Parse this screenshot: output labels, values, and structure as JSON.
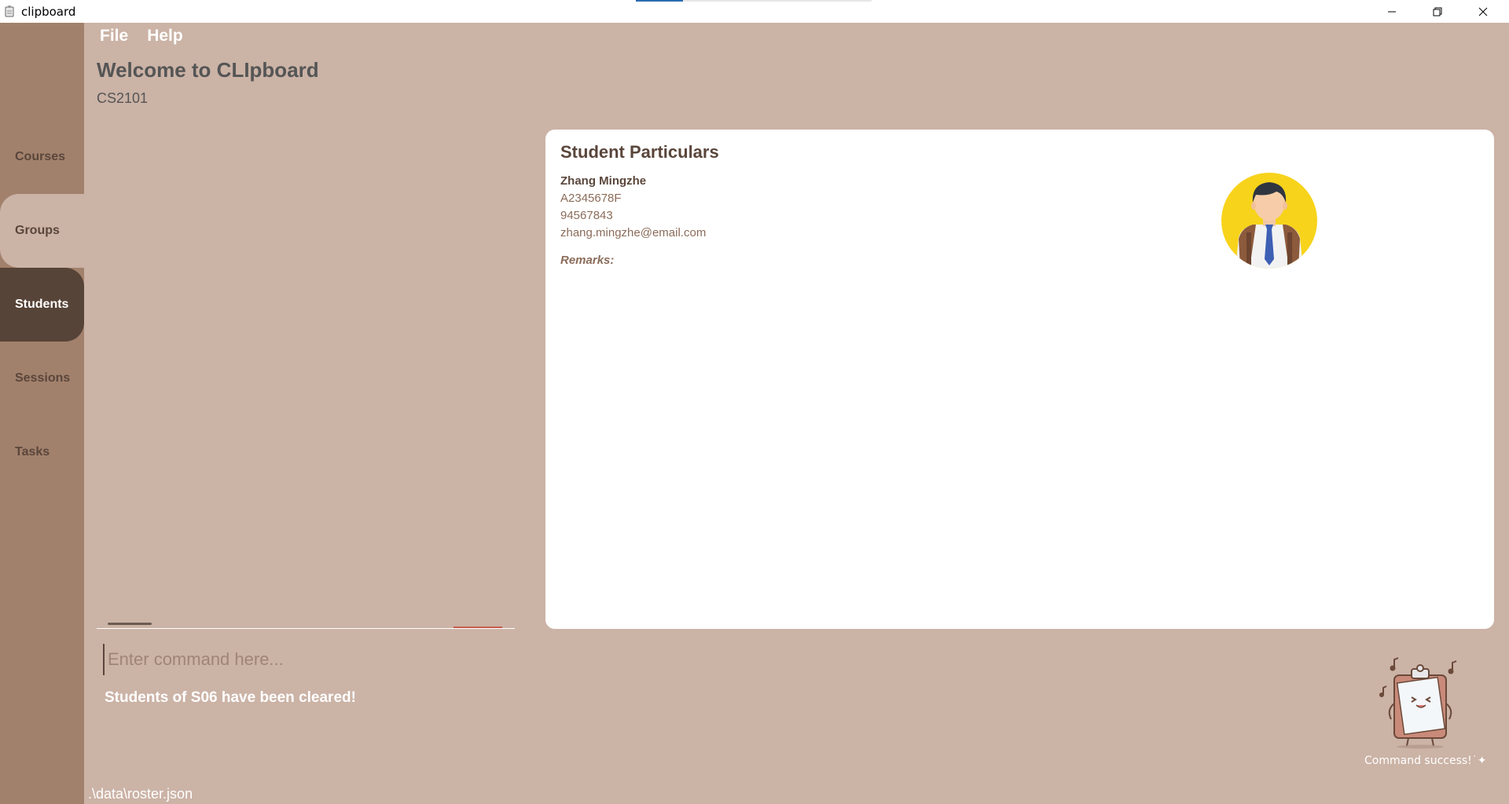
{
  "window": {
    "title": "clipboard",
    "controls": [
      "minimize-icon",
      "restore-icon",
      "close-icon"
    ]
  },
  "menu": {
    "file_label": "File",
    "help_label": "Help"
  },
  "header": {
    "welcome": "Welcome to CLIpboard",
    "course": "CS2101"
  },
  "sidebar": {
    "items": [
      {
        "label": "Courses",
        "state": "normal"
      },
      {
        "label": "Groups",
        "state": "hover"
      },
      {
        "label": "Students",
        "state": "active"
      },
      {
        "label": "Sessions",
        "state": "normal"
      },
      {
        "label": "Tasks",
        "state": "normal"
      }
    ]
  },
  "details": {
    "title": "Student Particulars",
    "name": "Zhang Mingzhe",
    "student_id": "A2345678F",
    "phone": "94567843",
    "email": "zhang.mingzhe@email.com",
    "remarks_label": "Remarks:",
    "avatar_icon": "student-avatar-icon"
  },
  "command": {
    "placeholder": "Enter command here...",
    "value": ""
  },
  "result": {
    "message": "Students of S06 have been cleared!"
  },
  "mascot": {
    "status": "Command success!˙✦"
  },
  "footer": {
    "path": ".\\data\\roster.json"
  },
  "colors": {
    "background": "#CBB3A6",
    "sidebar": "#A2816C",
    "active_tab": "#574438",
    "text_dark": "#5A463B",
    "text_brown": "#8B6C5A",
    "avatar_bg": "#F7D31B"
  }
}
